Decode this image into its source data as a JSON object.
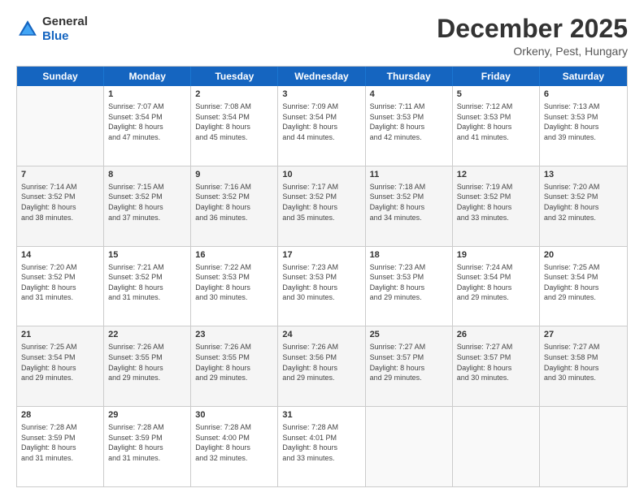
{
  "logo": {
    "general": "General",
    "blue": "Blue"
  },
  "header": {
    "title": "December 2025",
    "subtitle": "Orkeny, Pest, Hungary"
  },
  "days": [
    "Sunday",
    "Monday",
    "Tuesday",
    "Wednesday",
    "Thursday",
    "Friday",
    "Saturday"
  ],
  "weeks": [
    [
      {
        "day": "",
        "info": ""
      },
      {
        "day": "1",
        "info": "Sunrise: 7:07 AM\nSunset: 3:54 PM\nDaylight: 8 hours\nand 47 minutes."
      },
      {
        "day": "2",
        "info": "Sunrise: 7:08 AM\nSunset: 3:54 PM\nDaylight: 8 hours\nand 45 minutes."
      },
      {
        "day": "3",
        "info": "Sunrise: 7:09 AM\nSunset: 3:54 PM\nDaylight: 8 hours\nand 44 minutes."
      },
      {
        "day": "4",
        "info": "Sunrise: 7:11 AM\nSunset: 3:53 PM\nDaylight: 8 hours\nand 42 minutes."
      },
      {
        "day": "5",
        "info": "Sunrise: 7:12 AM\nSunset: 3:53 PM\nDaylight: 8 hours\nand 41 minutes."
      },
      {
        "day": "6",
        "info": "Sunrise: 7:13 AM\nSunset: 3:53 PM\nDaylight: 8 hours\nand 39 minutes."
      }
    ],
    [
      {
        "day": "7",
        "info": "Sunrise: 7:14 AM\nSunset: 3:52 PM\nDaylight: 8 hours\nand 38 minutes."
      },
      {
        "day": "8",
        "info": "Sunrise: 7:15 AM\nSunset: 3:52 PM\nDaylight: 8 hours\nand 37 minutes."
      },
      {
        "day": "9",
        "info": "Sunrise: 7:16 AM\nSunset: 3:52 PM\nDaylight: 8 hours\nand 36 minutes."
      },
      {
        "day": "10",
        "info": "Sunrise: 7:17 AM\nSunset: 3:52 PM\nDaylight: 8 hours\nand 35 minutes."
      },
      {
        "day": "11",
        "info": "Sunrise: 7:18 AM\nSunset: 3:52 PM\nDaylight: 8 hours\nand 34 minutes."
      },
      {
        "day": "12",
        "info": "Sunrise: 7:19 AM\nSunset: 3:52 PM\nDaylight: 8 hours\nand 33 minutes."
      },
      {
        "day": "13",
        "info": "Sunrise: 7:20 AM\nSunset: 3:52 PM\nDaylight: 8 hours\nand 32 minutes."
      }
    ],
    [
      {
        "day": "14",
        "info": "Sunrise: 7:20 AM\nSunset: 3:52 PM\nDaylight: 8 hours\nand 31 minutes."
      },
      {
        "day": "15",
        "info": "Sunrise: 7:21 AM\nSunset: 3:52 PM\nDaylight: 8 hours\nand 31 minutes."
      },
      {
        "day": "16",
        "info": "Sunrise: 7:22 AM\nSunset: 3:53 PM\nDaylight: 8 hours\nand 30 minutes."
      },
      {
        "day": "17",
        "info": "Sunrise: 7:23 AM\nSunset: 3:53 PM\nDaylight: 8 hours\nand 30 minutes."
      },
      {
        "day": "18",
        "info": "Sunrise: 7:23 AM\nSunset: 3:53 PM\nDaylight: 8 hours\nand 29 minutes."
      },
      {
        "day": "19",
        "info": "Sunrise: 7:24 AM\nSunset: 3:54 PM\nDaylight: 8 hours\nand 29 minutes."
      },
      {
        "day": "20",
        "info": "Sunrise: 7:25 AM\nSunset: 3:54 PM\nDaylight: 8 hours\nand 29 minutes."
      }
    ],
    [
      {
        "day": "21",
        "info": "Sunrise: 7:25 AM\nSunset: 3:54 PM\nDaylight: 8 hours\nand 29 minutes."
      },
      {
        "day": "22",
        "info": "Sunrise: 7:26 AM\nSunset: 3:55 PM\nDaylight: 8 hours\nand 29 minutes."
      },
      {
        "day": "23",
        "info": "Sunrise: 7:26 AM\nSunset: 3:55 PM\nDaylight: 8 hours\nand 29 minutes."
      },
      {
        "day": "24",
        "info": "Sunrise: 7:26 AM\nSunset: 3:56 PM\nDaylight: 8 hours\nand 29 minutes."
      },
      {
        "day": "25",
        "info": "Sunrise: 7:27 AM\nSunset: 3:57 PM\nDaylight: 8 hours\nand 29 minutes."
      },
      {
        "day": "26",
        "info": "Sunrise: 7:27 AM\nSunset: 3:57 PM\nDaylight: 8 hours\nand 30 minutes."
      },
      {
        "day": "27",
        "info": "Sunrise: 7:27 AM\nSunset: 3:58 PM\nDaylight: 8 hours\nand 30 minutes."
      }
    ],
    [
      {
        "day": "28",
        "info": "Sunrise: 7:28 AM\nSunset: 3:59 PM\nDaylight: 8 hours\nand 31 minutes."
      },
      {
        "day": "29",
        "info": "Sunrise: 7:28 AM\nSunset: 3:59 PM\nDaylight: 8 hours\nand 31 minutes."
      },
      {
        "day": "30",
        "info": "Sunrise: 7:28 AM\nSunset: 4:00 PM\nDaylight: 8 hours\nand 32 minutes."
      },
      {
        "day": "31",
        "info": "Sunrise: 7:28 AM\nSunset: 4:01 PM\nDaylight: 8 hours\nand 33 minutes."
      },
      {
        "day": "",
        "info": ""
      },
      {
        "day": "",
        "info": ""
      },
      {
        "day": "",
        "info": ""
      }
    ]
  ]
}
